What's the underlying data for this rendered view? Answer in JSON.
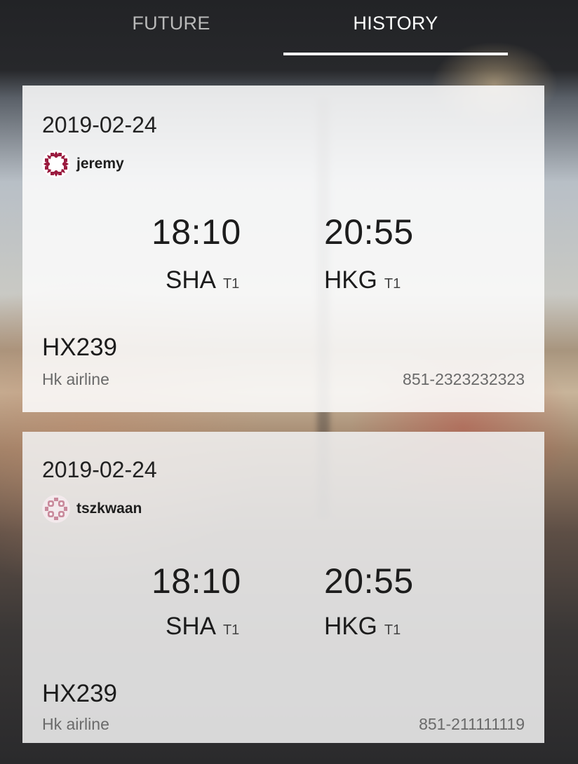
{
  "tabs": {
    "future_label": "FUTURE",
    "history_label": "HISTORY",
    "active": "HISTORY"
  },
  "flights": [
    {
      "date": "2019-02-24",
      "user": "jeremy",
      "avatar_icon": "identicon-star-pattern",
      "avatar_color": "#9b1b3f",
      "departure_time": "18:10",
      "departure_airport": "SHA",
      "departure_terminal": "T1",
      "arrival_time": "20:55",
      "arrival_airport": "HKG",
      "arrival_terminal": "T1",
      "flight_number": "HX239",
      "airline": "Hk airline",
      "phone": "851-2323232323"
    },
    {
      "date": "2019-02-24",
      "user": "tszkwaan",
      "avatar_icon": "identicon-grid-pattern",
      "avatar_color": "#c98a9c",
      "departure_time": "18:10",
      "departure_airport": "SHA",
      "departure_terminal": "T1",
      "arrival_time": "20:55",
      "arrival_airport": "HKG",
      "arrival_terminal": "T1",
      "flight_number": "HX239",
      "airline": "Hk airline",
      "phone": "851-211111119"
    }
  ]
}
